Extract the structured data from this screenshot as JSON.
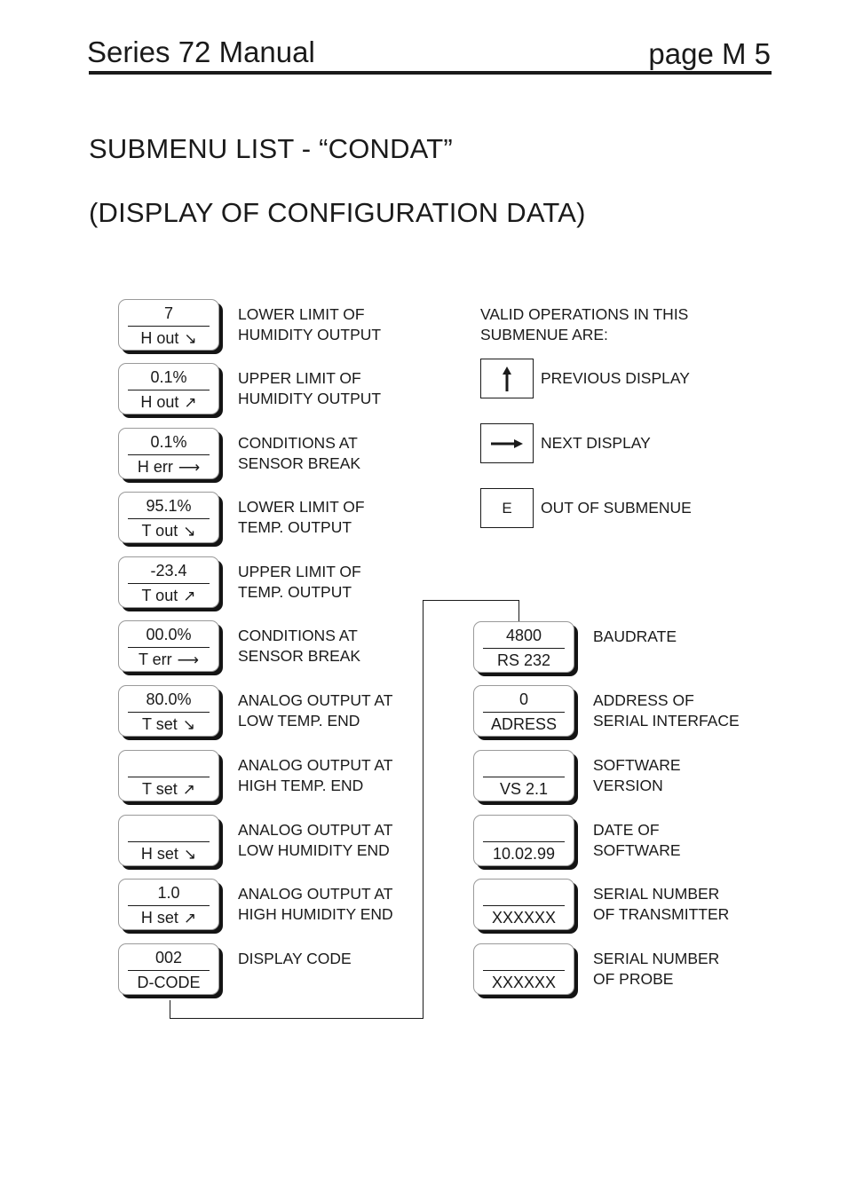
{
  "header": {
    "title": "Series 72 Manual",
    "page": "page  M 5"
  },
  "headings": {
    "line1": "SUBMENU LIST - “CONDAT”",
    "line2": "(DISPLAY OF CONFIGURATION DATA)"
  },
  "left_column": [
    {
      "value": "7",
      "label": "H out",
      "arrow": "↘",
      "description": "LOWER LIMIT OF\nHUMIDITY OUTPUT"
    },
    {
      "value": "0.1%",
      "label": "H out",
      "arrow": "↗",
      "description": "UPPER LIMIT OF\nHUMIDITY OUTPUT"
    },
    {
      "value": "0.1%",
      "label": "H err",
      "arrow": "⟶",
      "description": "CONDITIONS AT\nSENSOR BREAK"
    },
    {
      "value": "95.1%",
      "label": "T out",
      "arrow": "↘",
      "description": "LOWER LIMIT OF\nTEMP. OUTPUT"
    },
    {
      "value": "-23.4",
      "label": "T out",
      "arrow": "↗",
      "description": "UPPER LIMIT OF\nTEMP. OUTPUT"
    },
    {
      "value": "00.0%",
      "label": "T err",
      "arrow": "⟶",
      "description": "CONDITIONS AT\nSENSOR BREAK"
    },
    {
      "value": "80.0%",
      "label": "T set",
      "arrow": "↘",
      "description": "ANALOG OUTPUT AT\nLOW TEMP. END"
    },
    {
      "value": "",
      "label": "T set",
      "arrow": "↗",
      "description": "ANALOG OUTPUT AT\nHIGH TEMP. END"
    },
    {
      "value": "",
      "label": "H set",
      "arrow": "↘",
      "description": "ANALOG OUTPUT AT\nLOW HUMIDITY END"
    },
    {
      "value": "1.0",
      "label": "H set",
      "arrow": "↗",
      "description": "ANALOG OUTPUT AT\nHIGH HUMIDITY END"
    },
    {
      "value": "002",
      "label": "D-CODE",
      "arrow": "",
      "description": "DISPLAY CODE"
    }
  ],
  "right_column": [
    {
      "value": "4800",
      "label": "RS 232",
      "description": "BAUDRATE"
    },
    {
      "value": "0",
      "label": "ADRESS",
      "description": "ADDRESS OF\nSERIAL INTERFACE"
    },
    {
      "value": "",
      "label": "VS 2.1",
      "description": "SOFTWARE\nVERSION"
    },
    {
      "value": "",
      "label": "10.02.99",
      "description": "DATE OF\nSOFTWARE"
    },
    {
      "value": "",
      "label": "XXXXXX",
      "description": "SERIAL NUMBER\nOF TRANSMITTER"
    },
    {
      "value": "",
      "label": "XXXXXX",
      "description": "SERIAL NUMBER\nOF PROBE"
    }
  ],
  "operations": {
    "title": "VALID OPERATIONS IN THIS\nSUBMENUE ARE:",
    "items": [
      {
        "key_icon": "arrow-up-icon",
        "key_text": "",
        "label": "PREVIOUS DISPLAY"
      },
      {
        "key_icon": "arrow-right-icon",
        "key_text": "",
        "label": "NEXT DISPLAY"
      },
      {
        "key_icon": "",
        "key_text": "E",
        "label": "OUT OF SUBMENUE"
      }
    ]
  }
}
